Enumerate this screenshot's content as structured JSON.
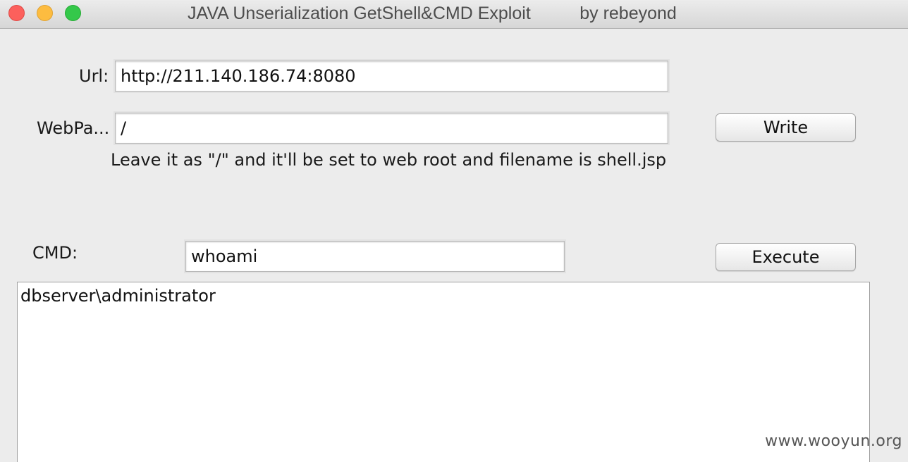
{
  "window": {
    "title": "JAVA Unserialization GetShell&CMD Exploit          by rebeyond",
    "controls": {
      "close": "close-icon",
      "minimize": "minimize-icon",
      "zoom": "zoom-icon"
    },
    "colors": {
      "close": "#fc605c",
      "minimize": "#fdbc40",
      "zoom": "#34c84a",
      "background": "#ececec"
    }
  },
  "form": {
    "url_label": "Url:",
    "url_value": "http://211.140.186.74:8080",
    "webpath_label": "WebPa...",
    "webpath_value": "/",
    "write_button": "Write",
    "hint": "Leave it as \"/\" and it'll be set to web root and filename is shell.jsp",
    "cmd_label": "CMD:",
    "cmd_value": "whoami",
    "execute_button": "Execute"
  },
  "output": {
    "text": "dbserver\\administrator"
  },
  "watermark": "www.wooyun.org"
}
